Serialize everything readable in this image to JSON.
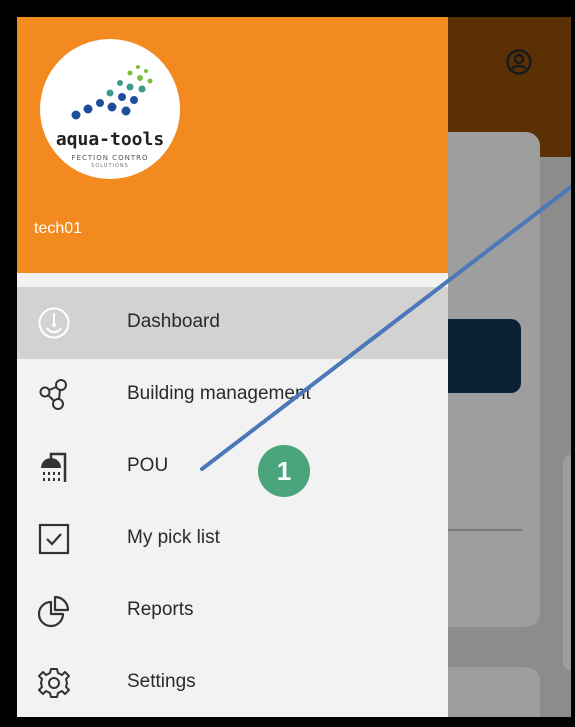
{
  "app": {
    "logo_text": "aqua-tools",
    "logo_tagline": "FECTION CONTRO",
    "logo_tagline2": "SOLUTIONS",
    "username": "tech01"
  },
  "menu": {
    "items": [
      {
        "label": "Dashboard",
        "icon": "dashboard-icon",
        "active": true
      },
      {
        "label": "Building management",
        "icon": "building-network-icon",
        "active": false
      },
      {
        "label": "POU",
        "icon": "shower-icon",
        "active": false
      },
      {
        "label": "My pick list",
        "icon": "checkbox-icon",
        "active": false
      },
      {
        "label": "Reports",
        "icon": "pie-chart-icon",
        "active": false
      },
      {
        "label": "Settings",
        "icon": "gear-icon",
        "active": false
      }
    ]
  },
  "annotation": {
    "badge_number": "1"
  },
  "colors": {
    "drawer_header": "#f28a1f",
    "active_item": "#d2d2d2",
    "badge": "#4aa57c",
    "arrow": "#4a78b8"
  }
}
